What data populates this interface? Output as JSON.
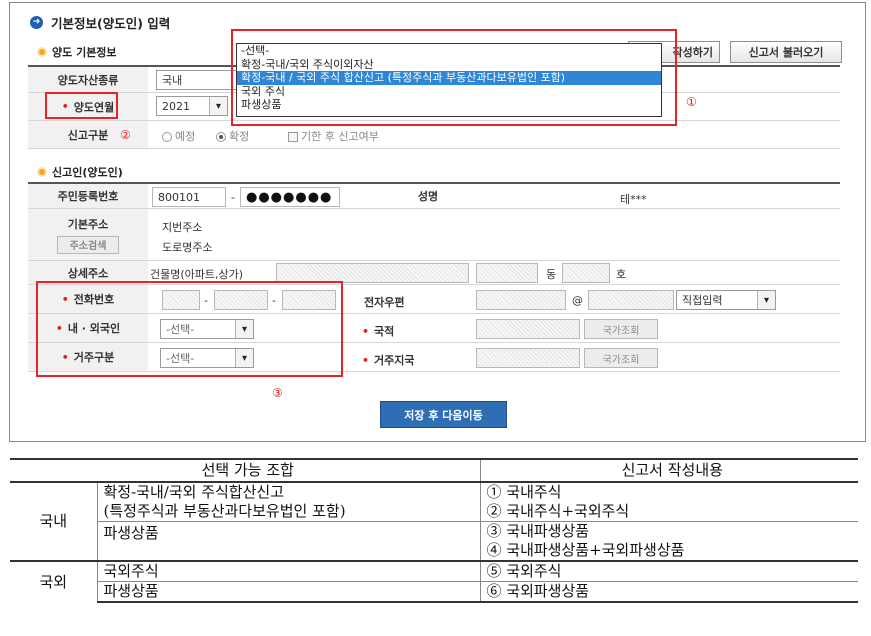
{
  "page_title": "기본정보(양도인) 입력",
  "section_transfer": "양도 기본정보",
  "top_buttons": {
    "write": "작성하기",
    "load": "신고서 불러오기"
  },
  "asset_type": {
    "label": "양도자산종류",
    "value": "국내"
  },
  "transfer_year": {
    "label": "양도연월",
    "value": "2021"
  },
  "report_type": {
    "label": "신고구분",
    "options": [
      "예정",
      "확정"
    ],
    "selected": "확정",
    "late_label": "기한 후 신고여부"
  },
  "dropdown": {
    "options": [
      "-선택-",
      "확정-국내/국외 주식이외자산",
      "확정-국내 / 국외 주식 합산신고 (특정주식과 부동산과다보유법인 포함)",
      "국외 주식",
      "파생상품"
    ],
    "selected_index": 2
  },
  "annotations": [
    "①",
    "②",
    "③"
  ],
  "section_reporter": "신고인(양도인)",
  "rrn": {
    "label": "주민등록번호",
    "front": "800101",
    "dash": "-",
    "back": "●●●●●●●"
  },
  "name": {
    "label": "성명",
    "value": "테***"
  },
  "address": {
    "label": "기본주소",
    "search_button": "주소검색",
    "jibun": "지번주소",
    "road": "도로명주소"
  },
  "detail_address": {
    "label": "상세주소",
    "building_prefix": "건물명(아파트,상가)",
    "dong": "동",
    "ho": "호"
  },
  "phone": {
    "label": "전화번호",
    "dash": "-"
  },
  "email": {
    "label": "전자우편",
    "at": "@",
    "domain_select": "직접입력"
  },
  "nationality_type": {
    "label": "내 · 외국인",
    "value": "-선택-"
  },
  "nationality": {
    "label": "국적",
    "button": "국가조회"
  },
  "residence_type": {
    "label": "거주구분",
    "value": "-선택-"
  },
  "residence_country": {
    "label": "거주지국",
    "button": "국가조회"
  },
  "save_button": "저장 후 다음이동",
  "ref_table": {
    "headers": [
      "선택 가능 조합",
      "신고서 작성내용"
    ],
    "domestic": "국내",
    "foreign": "국외",
    "domestic_combo1_line1": "확정-국내/국외 주식합산신고",
    "domestic_combo1_line2": "(특정주식과 부동산과다보유법인 포함)",
    "domestic_combo2": "파생상품",
    "foreign_combo1": "국외주식",
    "foreign_combo2": "파생상품",
    "content": [
      "① 국내주식",
      "② 국내주식+국외주식",
      "③ 국내파생상품",
      "④ 국내파생상품+국외파생상품",
      "⑤ 국외주식",
      "⑥ 국외파생상품"
    ]
  },
  "colors": {
    "accent_blue": "#2f6db5",
    "required_red": "#d22222",
    "annotation_red": "#e5232a",
    "highlight": "#2f86d6"
  }
}
